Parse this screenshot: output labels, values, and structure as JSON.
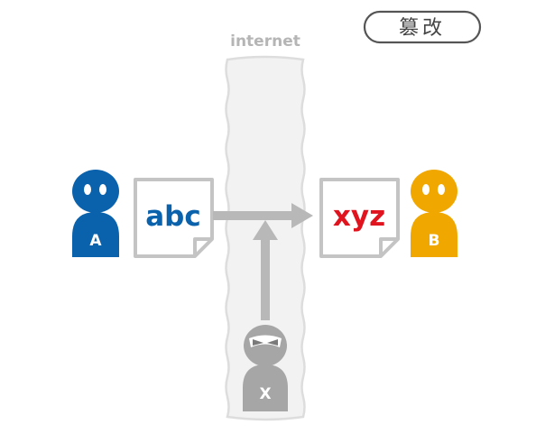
{
  "badge": {
    "label": "篡改"
  },
  "network": {
    "label": "internet"
  },
  "sender": {
    "letter": "A",
    "color": "#0a62ad"
  },
  "receiver": {
    "letter": "B",
    "color": "#f0a800"
  },
  "attacker": {
    "letter": "X",
    "color": "#a6a6a6"
  },
  "original_document": {
    "text": "abc",
    "color": "#0a62ad"
  },
  "tampered_document": {
    "text": "xyz",
    "color": "#e0141e"
  },
  "colors": {
    "arrow": "#b8b8b8",
    "document_border": "#c4c4c4",
    "internet_band_fill": "#f2f2f2",
    "internet_band_border": "#dddddd",
    "badge_border": "#555555"
  }
}
